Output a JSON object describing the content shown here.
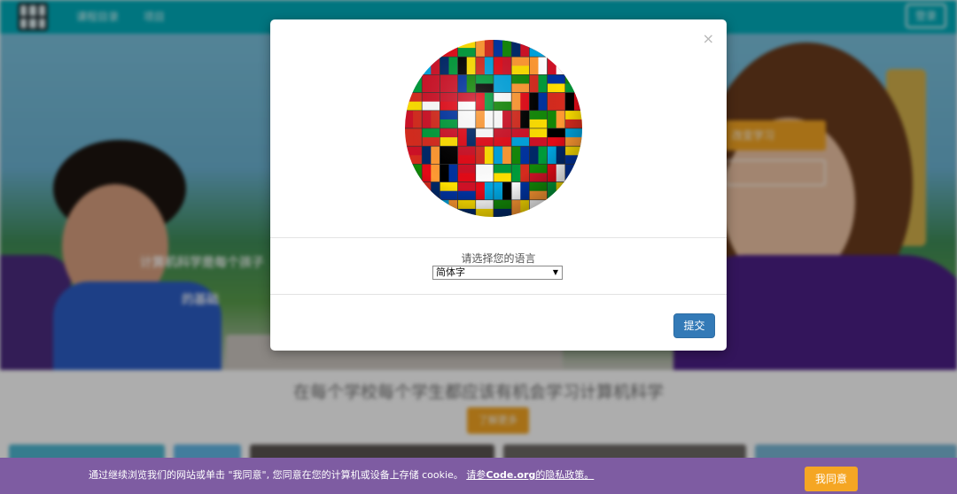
{
  "nav": {
    "link_1": "课程目录",
    "link_2": "项目",
    "sign_in": "登录"
  },
  "hero": {
    "cta_primary": "改变学习",
    "overlay_text_1": "计算机科学是每个孩子",
    "overlay_text_2": "的基础"
  },
  "page": {
    "headline": "在每个学校每个学生都应该有机会学习计算机科学",
    "learn_more": "了解更多"
  },
  "modal": {
    "close": "×",
    "prompt": "请选择您的语言",
    "selected_language": "简体字",
    "submit": "提交"
  },
  "cookie": {
    "message": "通过继续浏览我们的网站或单击 \"我同意\", 您同意在您的计算机或设备上存储 cookie。 ",
    "link_prefix": "请参",
    "link_brand": "Code.org",
    "link_suffix": "的隐私政策。",
    "agree": "我同意"
  },
  "colors": {
    "nav_bg": "#00adbc",
    "accent_orange": "#f5a623",
    "cookie_bg": "#7e5ca2",
    "submit_blue": "#337ab7"
  }
}
